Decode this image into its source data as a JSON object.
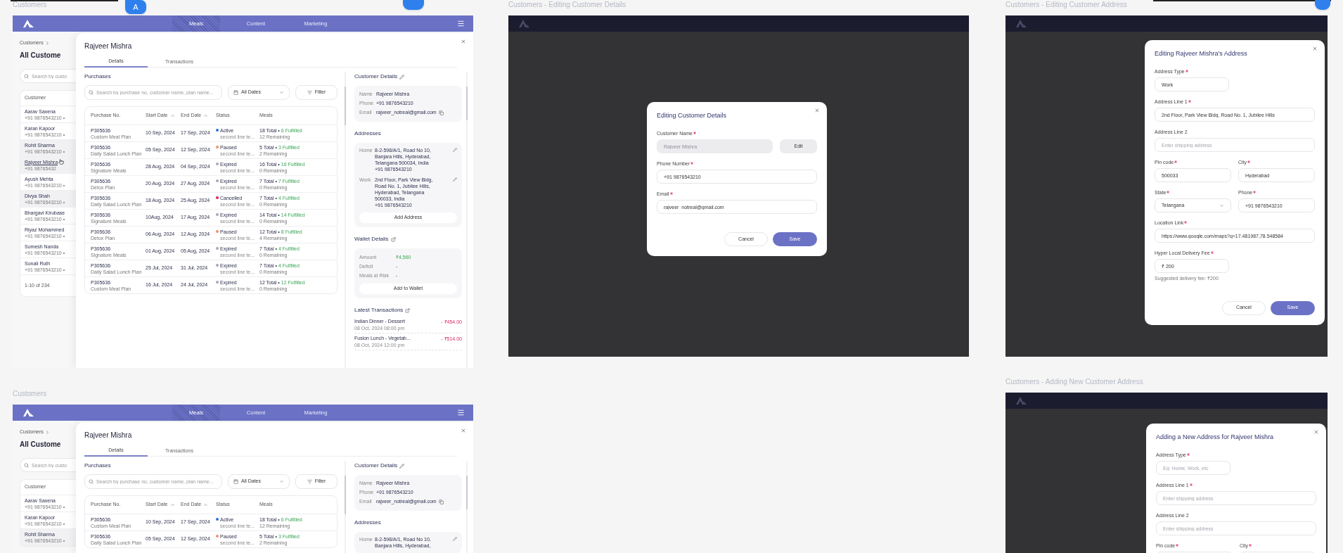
{
  "collaborator_badge": "A",
  "frames": [
    {
      "kind": "drawer",
      "label": "Customers",
      "nav": [
        {
          "label": "Meals",
          "selected": true
        },
        {
          "label": "Content",
          "selected": false
        },
        {
          "label": "Marketing",
          "selected": false
        }
      ],
      "page": {
        "breadcrumb": "Customers",
        "heading": "All Custome",
        "search_placeholder": "Search by custo",
        "column": "Customer",
        "customers": [
          {
            "name": "Aarav Saxena",
            "phone": "+91 9876543210 •",
            "highlighted": false,
            "hovered": false
          },
          {
            "name": "Karan Kapoor",
            "phone": "+91 9876543210 •",
            "highlighted": false,
            "hovered": false
          },
          {
            "name": "Rohit Sharma",
            "phone": "+91 9876543210 •",
            "highlighted": true,
            "hovered": false
          },
          {
            "name": "Rajveer Mishra",
            "phone": "+91 98765432",
            "highlighted": true,
            "hovered": true
          },
          {
            "name": "Ayush Mehta",
            "phone": "+91 9876543210 •",
            "highlighted": false,
            "hovered": false
          },
          {
            "name": "Divya Shah",
            "phone": "+91 9876543210 •",
            "highlighted": true,
            "hovered": false
          },
          {
            "name": "Bhargavi Kirubase",
            "phone": "+91 9876543210 •",
            "highlighted": false,
            "hovered": false
          },
          {
            "name": "Riyaz Mohammed",
            "phone": "+91 9876543210 •",
            "highlighted": false,
            "hovered": false
          },
          {
            "name": "Somesh Nanda",
            "phone": "+91 9876543210 •",
            "highlighted": false,
            "hovered": false
          },
          {
            "name": "Sonali Ruth",
            "phone": "+91 9876543210 •",
            "highlighted": false,
            "hovered": false
          }
        ],
        "pagination": "1-10 of 234"
      },
      "drawer": {
        "title": "Rajveer Mishra",
        "tabs": [
          {
            "label": "Details",
            "selected": true
          },
          {
            "label": "Transactions",
            "selected": false
          }
        ],
        "purchases": {
          "heading": "Purchases",
          "search_placeholder": "Search by purchase no, customer name, plan name...",
          "date_filter": "All Dates",
          "filter": "Filter",
          "columns": [
            {
              "label": "Purchase No.",
              "sortable": false
            },
            {
              "label": "Start Date",
              "sortable": true
            },
            {
              "label": "End Date",
              "sortable": true
            },
            {
              "label": "Status",
              "sortable": false
            },
            {
              "label": "Meals",
              "sortable": false
            }
          ],
          "rows": [
            {
              "purchase_no": "P305636",
              "plan": "Custom Meal Plan",
              "start": "10 Sep, 2024",
              "end": "17 Sep, 2024",
              "status": "Active",
              "status_note": "second line te...",
              "color": "#2f6fe0",
              "total": "18 Total •",
              "fulfilled": "6 Fulfilled",
              "remaining": "12 Remaining"
            },
            {
              "purchase_no": "P305636",
              "plan": "Daily Salad Lunch Plan",
              "start": "05 Sep, 2024",
              "end": "12 Sep, 2024",
              "status": "Paused",
              "status_note": "second line te...",
              "color": "#f0906a",
              "total": "5 Total •",
              "fulfilled": "3 Fulfilled",
              "remaining": "2 Remaining"
            },
            {
              "purchase_no": "P305636",
              "plan": "Signature Meals",
              "start": "28 Aug, 2024",
              "end": "04 Sep, 2024",
              "status": "Expired",
              "status_note": "second line te...",
              "color": "#a5a8b5",
              "total": "16 Total •",
              "fulfilled": "16 Fulfilled",
              "remaining": "0 Remaining"
            },
            {
              "purchase_no": "P305636",
              "plan": "Detox Plan",
              "start": "20 Aug, 2024",
              "end": "27 Aug, 2024",
              "status": "Expired",
              "status_note": "second line te...",
              "color": "#a5a8b5",
              "total": "7 Total •",
              "fulfilled": "7 Fulfilled",
              "remaining": "0 Remaining"
            },
            {
              "purchase_no": "P305636",
              "plan": "Daily Salad Lunch Plan",
              "start": "18 Aug, 2024",
              "end": "25 Aug, 2024",
              "status": "Cancelled",
              "status_note": "second line te...",
              "color": "#e0245e",
              "total": "7 Total •",
              "fulfilled": "4 Fulfilled",
              "remaining": "0 Remaining"
            },
            {
              "purchase_no": "P305636",
              "plan": "Signature Meals",
              "start": "10Aug, 2024",
              "end": "17 Aug, 2024",
              "status": "Expired",
              "status_note": "second line te...",
              "color": "#a5a8b5",
              "total": "14 Total •",
              "fulfilled": "14 Fulfilled",
              "remaining": "0 Remaining"
            },
            {
              "purchase_no": "P305636",
              "plan": "Detox Plan",
              "start": "06 Aug, 2024",
              "end": "12 Aug, 2024",
              "status": "Paused",
              "status_note": "second line te...",
              "color": "#f0906a",
              "total": "12 Total •",
              "fulfilled": "8 Fulfilled",
              "remaining": "4 Remaining"
            },
            {
              "purchase_no": "P305636",
              "plan": "Signature Meals",
              "start": "01 Aug, 2024",
              "end": "05 Aug, 2024",
              "status": "Expired",
              "status_note": "second line te...",
              "color": "#a5a8b5",
              "total": "7 Total •",
              "fulfilled": "4 Fulfilled",
              "remaining": "0 Remaining"
            },
            {
              "purchase_no": "P305636",
              "plan": "Daily Salad Lunch Plan",
              "start": "25 Jul, 2024",
              "end": "31 Jul, 2024",
              "status": "Expired",
              "status_note": "second line te...",
              "color": "#a5a8b5",
              "total": "7 Total •",
              "fulfilled": "4 Fulfilled",
              "remaining": "0 Remaining"
            },
            {
              "purchase_no": "P305636",
              "plan": "Custom Meal Plan",
              "start": "16 Jul, 2024",
              "end": "24 Jul, 2024",
              "status": "Expired",
              "status_note": "second line te...",
              "color": "#a5a8b5",
              "total": "12 Total •",
              "fulfilled": "12 Fulfilled",
              "remaining": "0 Remaining"
            }
          ]
        },
        "customer_details": {
          "heading": "Customer Details",
          "fields": [
            {
              "label": "Name",
              "value": "Rajveer Mishra",
              "copyable": false
            },
            {
              "label": "Phone",
              "value": "+91 9876543210",
              "copyable": false
            },
            {
              "label": "Email",
              "value": "rajveer_notreal@gmail.com",
              "copyable": true
            }
          ]
        },
        "addresses": {
          "heading": "Addresses",
          "items": [
            {
              "type": "Home",
              "lines": [
                "8-2-598/A/1, Road No 10,",
                "Banjara Hills, Hyderabad,",
                "Telangana 500034, India",
                "+91 9876543210"
              ]
            },
            {
              "type": "Work",
              "lines": [
                "2nd Floor, Park View Bldg,",
                "Road No. 1, Jubilee Hills,",
                "Hyderabad, Telangana",
                "500033,  India",
                "+91 9876543210"
              ]
            }
          ],
          "add_button": "Add Address"
        },
        "wallet": {
          "heading": "Wallet Details",
          "rows": [
            {
              "label": "Amount",
              "value": "₹4,560",
              "kind": "balance"
            },
            {
              "label": "Deficit",
              "value": "-",
              "kind": "plain"
            },
            {
              "label": "Meals at Risk",
              "value": "-",
              "kind": "plain"
            }
          ],
          "button": "Add to Wallet"
        },
        "transactions": {
          "heading": "Latest Transactions",
          "items": [
            {
              "name": "Indian Dinner - Dessert",
              "time": "08 Oct, 2024 08:00 pm",
              "amount": "- ₹454.00"
            },
            {
              "name": "Fusion Lunch - Vegetab...",
              "time": "08 Oct, 2024 12:00 pm",
              "amount": "- ₹514.00"
            }
          ]
        }
      }
    },
    {
      "kind": "dialog",
      "label": "Customers - Editing Customer Details",
      "dialog": {
        "title": "Editing Customer Details",
        "rows": [
          {
            "fields": [
              {
                "label": "Customer Name",
                "required": true,
                "kind": "text",
                "value": "Rajveer Mishra",
                "disabled": true,
                "action": "Edit"
              }
            ]
          },
          {
            "fields": [
              {
                "label": "Phone Number",
                "required": true,
                "kind": "text",
                "value": "+91 9876543210",
                "disabled": false
              }
            ]
          },
          {
            "fields": [
              {
                "label": "Email",
                "required": true,
                "kind": "text",
                "value": "rajveer_notreal@gmail.com",
                "disabled": false
              }
            ]
          }
        ],
        "cancel": "Cancel",
        "save": "Save"
      }
    },
    {
      "kind": "dialog",
      "label": "Customers - Editing Customer Address",
      "dialog": {
        "title": "Editing Rajveer Mishra's Address",
        "rows": [
          {
            "fields": [
              {
                "label": "Address Type",
                "required": true,
                "kind": "short",
                "value": "Work"
              }
            ]
          },
          {
            "fields": [
              {
                "label": "Address Line 1",
                "required": true,
                "kind": "text",
                "value": "2nd Floor, Park View Bldg, Road No. 1, Jubilee Hills"
              }
            ]
          },
          {
            "fields": [
              {
                "label": "Address Line 2",
                "required": false,
                "kind": "text",
                "placeholder": "Enter shipping address"
              }
            ]
          },
          {
            "fields": [
              {
                "label": "Pin code",
                "required": true,
                "kind": "text",
                "value": "500033"
              },
              {
                "label": "City",
                "required": true,
                "kind": "text",
                "value": "Hyderabad"
              }
            ]
          },
          {
            "fields": [
              {
                "label": "State",
                "required": true,
                "kind": "select",
                "value": "Telangana"
              },
              {
                "label": "Phone",
                "required": true,
                "kind": "text",
                "value": "+91 9876543210"
              }
            ]
          },
          {
            "fields": [
              {
                "label": "Location Link",
                "required": true,
                "kind": "text",
                "value": "https://www.google.com/maps?q=17.481987,78.548584"
              }
            ]
          },
          {
            "fields": [
              {
                "label": "Hyper Local Delivery Fee",
                "required": true,
                "kind": "short",
                "value": "₹ 200",
                "hint": "Suggested delivery fee: ₹200"
              }
            ]
          }
        ],
        "cancel": "Cancel",
        "save": "Save"
      }
    },
    {
      "kind": "drawer",
      "label": "Customers",
      "nav": [
        {
          "label": "Meals",
          "selected": true
        },
        {
          "label": "Content",
          "selected": false
        },
        {
          "label": "Marketing",
          "selected": false
        }
      ],
      "page": {
        "breadcrumb": "Customers",
        "heading": "All Custome",
        "search_placeholder": "Search by custo",
        "column": "Customer",
        "customers": [
          {
            "name": "Aarav Saxena",
            "phone": "+91 9876543210 •",
            "highlighted": false,
            "hovered": false
          },
          {
            "name": "Karan Kapoor",
            "phone": "+91 9876543210 •",
            "highlighted": false,
            "hovered": false
          },
          {
            "name": "Rohit Sharma",
            "phone": "+91 9876543210 •",
            "highlighted": true,
            "hovered": false
          }
        ]
      },
      "drawer": {
        "title": "Rajveer Mishra",
        "tabs": [
          {
            "label": "Details",
            "selected": true
          },
          {
            "label": "Transactions",
            "selected": false
          }
        ],
        "purchases": {
          "heading": "Purchases",
          "search_placeholder": "Search by purchase no, customer name, plan name...",
          "date_filter": "All Dates",
          "filter": "Filter",
          "columns": [
            {
              "label": "Purchase No.",
              "sortable": false
            },
            {
              "label": "Start Date",
              "sortable": true
            },
            {
              "label": "End Date",
              "sortable": true
            },
            {
              "label": "Status",
              "sortable": false
            },
            {
              "label": "Meals",
              "sortable": false
            }
          ],
          "rows": [
            {
              "purchase_no": "P305636",
              "plan": "Custom Meal Plan",
              "start": "10 Sep, 2024",
              "end": "17 Sep, 2024",
              "status": "Active",
              "status_note": "second line te...",
              "color": "#2f6fe0",
              "total": "18 Total •",
              "fulfilled": "6 Fulfilled",
              "remaining": "12 Remaining"
            },
            {
              "purchase_no": "P305636",
              "plan": "Daily Salad Lunch Plan",
              "start": "05 Sep, 2024",
              "end": "12 Sep, 2024",
              "status": "Paused",
              "status_note": "second line te...",
              "color": "#f0906a",
              "total": "5 Total •",
              "fulfilled": "3 Fulfilled",
              "remaining": "2 Remaining"
            }
          ]
        },
        "customer_details": {
          "heading": "Customer Details",
          "fields": [
            {
              "label": "Name",
              "value": "Rajveer Mishra",
              "copyable": false
            },
            {
              "label": "Phone",
              "value": "+91 9876543210",
              "copyable": false
            },
            {
              "label": "Email",
              "value": "rajveer_notreal@gmail.com",
              "copyable": true
            }
          ]
        },
        "addresses": {
          "heading": "Addresses",
          "items": [
            {
              "type": "Home",
              "lines": [
                "8-2-598/A/1, Road No 10,",
                "Banjara Hills, Hyderabad,"
              ]
            }
          ]
        }
      }
    },
    {
      "kind": "dialog",
      "label": "Customers - Adding New Customer Address",
      "dialog": {
        "title": "Adding a New Address for Rajveer Mishra",
        "rows": [
          {
            "fields": [
              {
                "label": "Address Type",
                "required": true,
                "kind": "short",
                "placeholder": "Eg: Home, Work, etc"
              }
            ]
          },
          {
            "fields": [
              {
                "label": "Address Line 1",
                "required": true,
                "kind": "text",
                "placeholder": "Enter shipping address"
              }
            ]
          },
          {
            "fields": [
              {
                "label": "Address Line 2",
                "required": false,
                "kind": "text",
                "placeholder": "Enter shipping address"
              }
            ]
          },
          {
            "fields": [
              {
                "label": "Pin code",
                "required": true,
                "kind": "text"
              },
              {
                "label": "City",
                "required": true,
                "kind": "text"
              }
            ]
          }
        ]
      }
    }
  ]
}
